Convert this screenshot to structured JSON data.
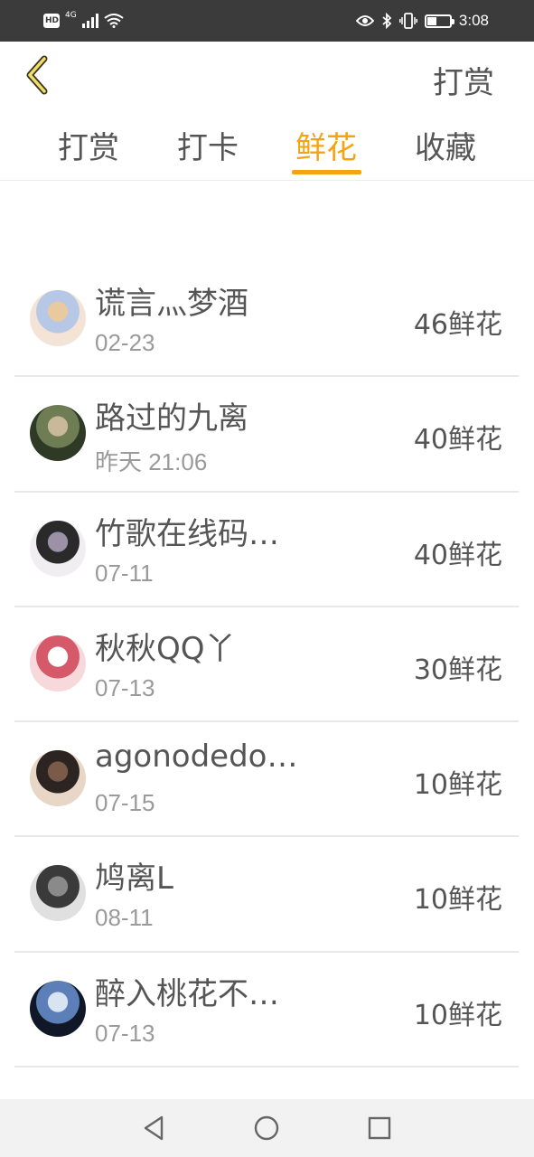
{
  "status_bar": {
    "hd": "HD",
    "network": "4G",
    "time": "3:08",
    "battery_level": 0.45,
    "icons": [
      "signal-icon",
      "wifi-icon",
      "eye-icon",
      "bluetooth-icon",
      "vibrate-icon",
      "battery-icon"
    ]
  },
  "header": {
    "back_icon": "chevron-left-icon",
    "title": "打赏"
  },
  "tabs": [
    {
      "label": "打赏",
      "active": false
    },
    {
      "label": "打卡",
      "active": false
    },
    {
      "label": "鲜花",
      "active": true
    },
    {
      "label": "收藏",
      "active": false
    }
  ],
  "accent_color": "#f5a310",
  "list": [
    {
      "name": "谎言灬梦酒",
      "date": "02-23",
      "amount": "46鲜花",
      "avatar_colors": [
        "#f4e4d8",
        "#b7c7e6",
        "#e8c9a0"
      ]
    },
    {
      "name": "路过的九离",
      "date": "昨天 21:06",
      "amount": "40鲜花",
      "avatar_colors": [
        "#2e3a26",
        "#6f7d55",
        "#c9b89a"
      ]
    },
    {
      "name": "竹歌在线码…",
      "date": "07-11",
      "amount": "40鲜花",
      "avatar_colors": [
        "#f1eef2",
        "#2a2a2a",
        "#9c92a8"
      ]
    },
    {
      "name": "秋秋QQ丫",
      "date": "07-13",
      "amount": "30鲜花",
      "avatar_colors": [
        "#f7d9dc",
        "#d6596a",
        "#ffffff"
      ]
    },
    {
      "name": "agonodedo…",
      "date": "07-15",
      "amount": "10鲜花",
      "avatar_colors": [
        "#e8d6c6",
        "#2b2420",
        "#7a5a48"
      ]
    },
    {
      "name": "鸠离L",
      "date": "08-11",
      "amount": "10鲜花",
      "avatar_colors": [
        "#e0e0e0",
        "#3a3a3a",
        "#8a8a8a"
      ]
    },
    {
      "name": "醉入桃花不…",
      "date": "07-13",
      "amount": "10鲜花",
      "avatar_colors": [
        "#101828",
        "#5c7fb8",
        "#d8e4f2"
      ]
    }
  ],
  "nav_bar": {
    "buttons": [
      "back-triangle-icon",
      "home-circle-icon",
      "recents-square-icon"
    ]
  }
}
